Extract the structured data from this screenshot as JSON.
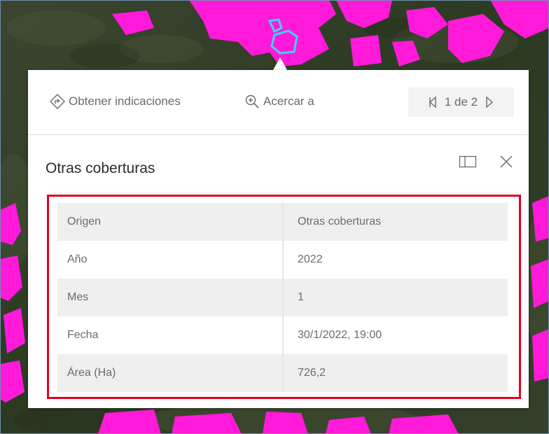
{
  "popup": {
    "actions": {
      "directions_label": "Obtener indicaciones",
      "zoom_label": "Acercar a"
    },
    "pager": {
      "count_label": "1 de 2"
    },
    "title": "Otras coberturas",
    "attributes": [
      {
        "key": "Origen",
        "value": "Otras coberturas"
      },
      {
        "key": "Año",
        "value": "2022"
      },
      {
        "key": "Mes",
        "value": "1"
      },
      {
        "key": "Fecha",
        "value": "30/1/2022, 19:00"
      },
      {
        "key": "Área (Ha)",
        "value": "726,2"
      }
    ]
  },
  "icons": {
    "directions": "directions-icon",
    "zoom": "zoom-in-icon",
    "prev": "chevron-left-icon",
    "next": "chevron-right-icon",
    "dock": "dock-icon",
    "close": "close-icon",
    "feature": "selected-feature-icon"
  },
  "colors": {
    "deforestation_overlay": "#ff1ad9",
    "selection_highlight": "#3ad6f0",
    "annotation_box": "#e3001b",
    "text_muted": "#6b6b6b",
    "title_text": "#2b2b2b",
    "row_shade": "#efefef"
  }
}
